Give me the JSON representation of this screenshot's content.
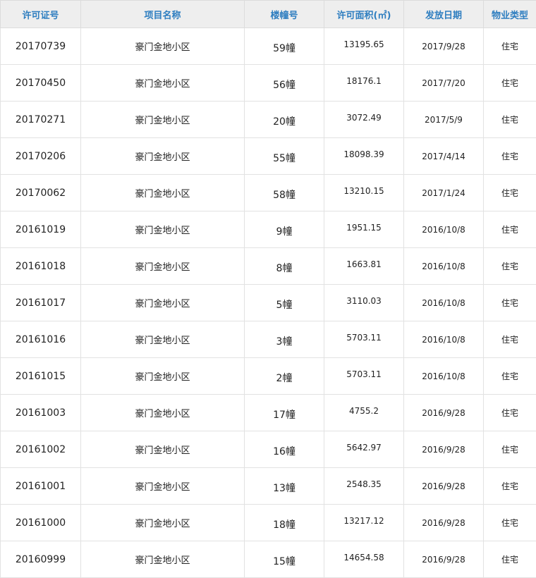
{
  "table": {
    "columns": [
      "许可证号",
      "项目名称",
      "楼幢号",
      "许可面积(㎡)",
      "发放日期",
      "物业类型"
    ],
    "rows": [
      [
        "20170739",
        "豪门金地小区",
        "59幢",
        "13195.65",
        "2017/9/28",
        "住宅"
      ],
      [
        "20170450",
        "豪门金地小区",
        "56幢",
        "18176.1",
        "2017/7/20",
        "住宅"
      ],
      [
        "20170271",
        "豪门金地小区",
        "20幢",
        "3072.49",
        "2017/5/9",
        "住宅"
      ],
      [
        "20170206",
        "豪门金地小区",
        "55幢",
        "18098.39",
        "2017/4/14",
        "住宅"
      ],
      [
        "20170062",
        "豪门金地小区",
        "58幢",
        "13210.15",
        "2017/1/24",
        "住宅"
      ],
      [
        "20161019",
        "豪门金地小区",
        "9幢",
        "1951.15",
        "2016/10/8",
        "住宅"
      ],
      [
        "20161018",
        "豪门金地小区",
        "8幢",
        "1663.81",
        "2016/10/8",
        "住宅"
      ],
      [
        "20161017",
        "豪门金地小区",
        "5幢",
        "3110.03",
        "2016/10/8",
        "住宅"
      ],
      [
        "20161016",
        "豪门金地小区",
        "3幢",
        "5703.11",
        "2016/10/8",
        "住宅"
      ],
      [
        "20161015",
        "豪门金地小区",
        "2幢",
        "5703.11",
        "2016/10/8",
        "住宅"
      ],
      [
        "20161003",
        "豪门金地小区",
        "17幢",
        "4755.2",
        "2016/9/28",
        "住宅"
      ],
      [
        "20161002",
        "豪门金地小区",
        "16幢",
        "5642.97",
        "2016/9/28",
        "住宅"
      ],
      [
        "20161001",
        "豪门金地小区",
        "13幢",
        "2548.35",
        "2016/9/28",
        "住宅"
      ],
      [
        "20161000",
        "豪门金地小区",
        "18幢",
        "13217.12",
        "2016/9/28",
        "住宅"
      ],
      [
        "20160999",
        "豪门金地小区",
        "15幢",
        "14654.58",
        "2016/9/28",
        "住宅"
      ]
    ]
  },
  "colors": {
    "header_text": "#2e7ec0",
    "header_bg": "#eeeeee",
    "grid_line": "#e2e2e2",
    "cell_text": "#222222"
  }
}
